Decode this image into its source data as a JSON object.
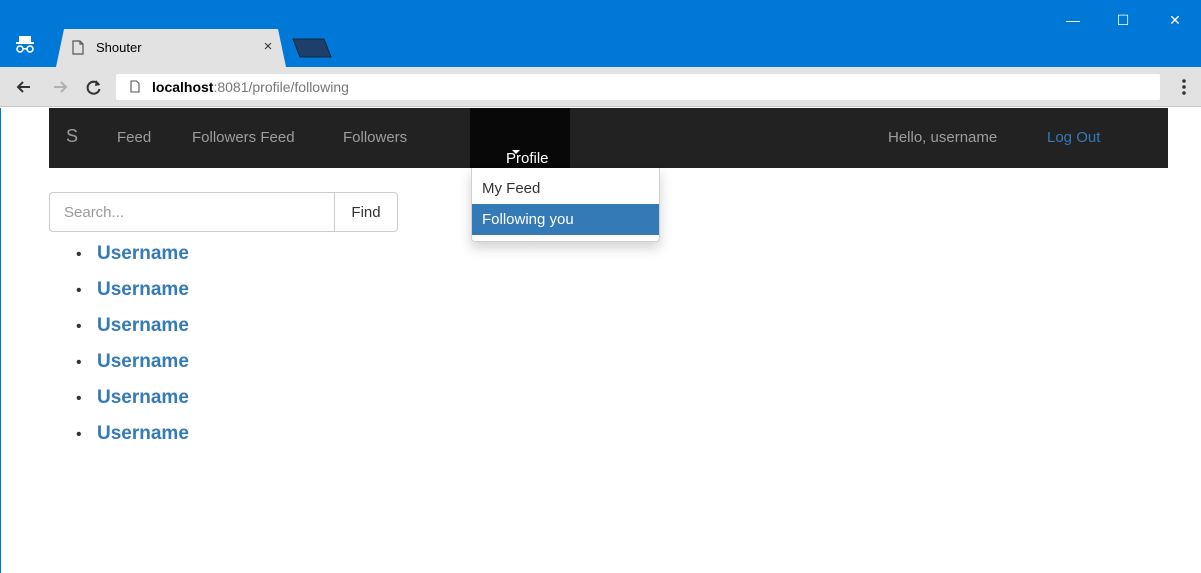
{
  "browser": {
    "tab_title": "Shouter",
    "tab_close": "×",
    "url_host": "localhost",
    "url_rest": ":8081/profile/following",
    "window_controls": {
      "minimize": "—",
      "maximize": "☐",
      "close": "✕"
    },
    "icons": [
      "incognito-icon",
      "page-icon",
      "back-icon",
      "forward-icon",
      "reload-icon",
      "menu-icon"
    ]
  },
  "navbar": {
    "brand": "S",
    "links": [
      "Feed",
      "Followers Feed",
      "Followers"
    ],
    "active": "Profile",
    "greeting": "Hello, username",
    "logout": "Log Out"
  },
  "dropdown": {
    "items": [
      {
        "label": "My Feed",
        "active": false
      },
      {
        "label": "Following you",
        "active": true
      }
    ]
  },
  "search": {
    "placeholder": "Search...",
    "value": "",
    "button": "Find"
  },
  "users": [
    "Username",
    "Username",
    "Username",
    "Username",
    "Username",
    "Username"
  ],
  "colors": {
    "titlebar": "#0078d7",
    "navbar": "#222222",
    "link": "#337ab7",
    "dropdown_active": "#337ab7"
  }
}
